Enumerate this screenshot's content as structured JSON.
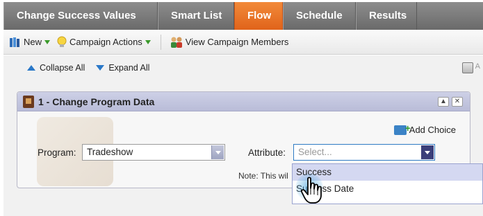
{
  "tabs": [
    {
      "label": "Change Success Values",
      "active": false
    },
    {
      "label": "Smart List",
      "active": false
    },
    {
      "label": "Flow",
      "active": true
    },
    {
      "label": "Schedule",
      "active": false
    },
    {
      "label": "Results",
      "active": false
    }
  ],
  "toolbar": {
    "new_label": "New",
    "campaign_actions_label": "Campaign Actions",
    "view_members_label": "View Campaign Members"
  },
  "subbar": {
    "collapse_label": "Collapse All",
    "expand_label": "Expand All",
    "save_tail": "A"
  },
  "card": {
    "title": "1 - Change Program Data",
    "add_choice_label": "Add Choice",
    "program_label": "Program:",
    "program_value": "Tradeshow",
    "attribute_label": "Attribute:",
    "attribute_placeholder": "Select...",
    "note": "Note: This wil"
  },
  "dropdown": {
    "options": [
      "Success",
      "Success Date"
    ],
    "highlighted": "Success"
  },
  "colors": {
    "active_tab": "#e8732a",
    "tab_bar": "#7a7a7a",
    "card_header": "#c3c6e0",
    "link_blue": "#2a78c8"
  }
}
